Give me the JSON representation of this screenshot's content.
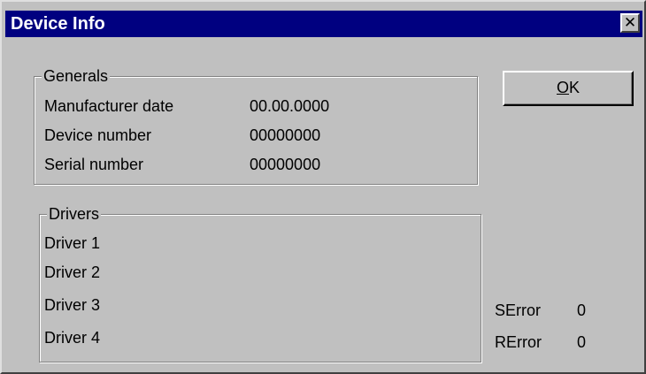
{
  "window": {
    "title": "Device Info",
    "close_glyph": "✕"
  },
  "buttons": {
    "ok_accel": "O",
    "ok_rest": "K"
  },
  "generals": {
    "legend": "Generals",
    "rows": [
      {
        "label": "Manufacturer date",
        "value": "00.00.0000"
      },
      {
        "label": "Device number",
        "value": "00000000"
      },
      {
        "label": "Serial number",
        "value": "00000000"
      }
    ]
  },
  "drivers": {
    "legend": "Drivers",
    "items": [
      "Driver 1",
      "Driver 2",
      "Driver 3",
      "Driver 4"
    ]
  },
  "errors": {
    "serror_label": "SError",
    "serror_value": "0",
    "rerror_label": "RError",
    "rerror_value": "0"
  },
  "colors": {
    "titlebar": "#000080",
    "face": "#c0c0c0"
  }
}
